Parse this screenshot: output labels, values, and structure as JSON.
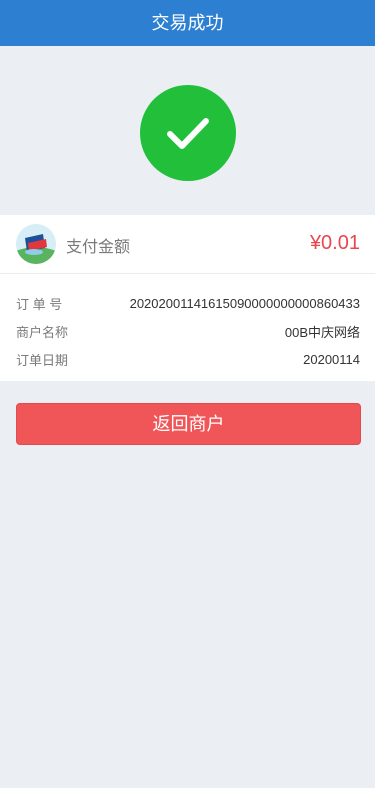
{
  "header": {
    "title": "交易成功"
  },
  "success": {
    "icon": "check-circle-icon",
    "color": "#22bf3a"
  },
  "payment": {
    "label": "支付金额",
    "amount": "¥0.01",
    "amount_color": "#e8474e",
    "logo_icon": "bank-logo-icon"
  },
  "details": [
    {
      "label": "订 单 号",
      "value": "20202001141615090000000000860433"
    },
    {
      "label": "商户名称",
      "value": "00B中庆网络"
    },
    {
      "label": "订单日期",
      "value": "20200114"
    }
  ],
  "actions": {
    "return_label": "返回商户"
  },
  "colors": {
    "header": "#2d7fd2",
    "background": "#ebeff3",
    "button": "#f05558"
  }
}
